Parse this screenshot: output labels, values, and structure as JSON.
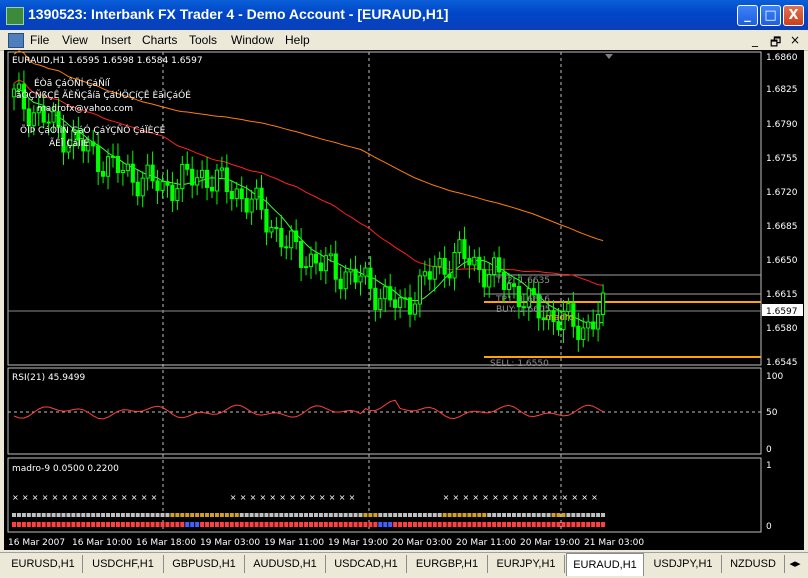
{
  "window": {
    "title": "1390523: Interbank FX Trader 4 - Demo Account - [EURAUD,H1]",
    "minimize": "_",
    "maximize": "□",
    "close": "X"
  },
  "menu": {
    "items": [
      "File",
      "View",
      "Insert",
      "Charts",
      "Tools",
      "Window",
      "Help"
    ],
    "mdi_minimize": "_",
    "mdi_restore": "🗗",
    "mdi_close": "×"
  },
  "chart": {
    "header": "EURAUD,H1  1.6595 1.6598 1.6584 1.6597",
    "overlay_text": [
      "ÉÒã ÇáÔÑÍ ÇáÑíÏ",
      "ãÔÇÑßÇÊ ÃÈÑÇåíã ÇáÚÖÇíÇÊ ÈãÌÇáÓÉ",
      "madrofx@yahoo.com",
      "ÕÏÞ ÇáÓÏíÑ ÇáÓ ÇáÝÇÑÓ ÇáÏÈÇÈ",
      "ÃÈÏ ÇáÌÏÉ"
    ],
    "price_labels": [
      "1.6860",
      "1.6825",
      "1.6790",
      "1.6755",
      "1.6720",
      "1.6685",
      "1.6650",
      "1.6615",
      "1.6580",
      "1.6545"
    ],
    "current_price": "1.6597",
    "levels": {
      "tp2": "TP2: 1.6635",
      "tp1": "TP1: 1.6616",
      "buy": "BUY: 1.6605",
      "sell": "SELL: 1.6550",
      "tag": "madro"
    },
    "rsi_label": "RSI(21) 45.9499",
    "rsi_scale": [
      "100",
      "50",
      "0"
    ],
    "madro_label": "madro-9 0.0500 0.2200",
    "madro_scale": [
      "1",
      "0"
    ],
    "time_labels": [
      "16 Mar 2007",
      "16 Mar 10:00",
      "16 Mar 18:00",
      "19 Mar 03:00",
      "19 Mar 11:00",
      "19 Mar 19:00",
      "20 Mar 03:00",
      "20 Mar 11:00",
      "20 Mar 19:00",
      "21 Mar 03:00"
    ],
    "colors": {
      "bull": "#00ff00",
      "bear": "#00ff00",
      "ma_slow": "#ff7f00",
      "ma_mid": "#ff2020",
      "ma_fast": "#3cff3c",
      "rsi": "#ff4040",
      "tp": "#a0a0a0",
      "entry": "#ffa500"
    }
  },
  "tabs": [
    "EURUSD,H1",
    "USDCHF,H1",
    "GBPUSD,H1",
    "AUDUSD,H1",
    "USDCAD,H1",
    "EURGBP,H1",
    "EURJPY,H1",
    "EURAUD,H1",
    "USDJPY,H1",
    "NZDUSD"
  ],
  "active_tab": "EURAUD,H1"
}
